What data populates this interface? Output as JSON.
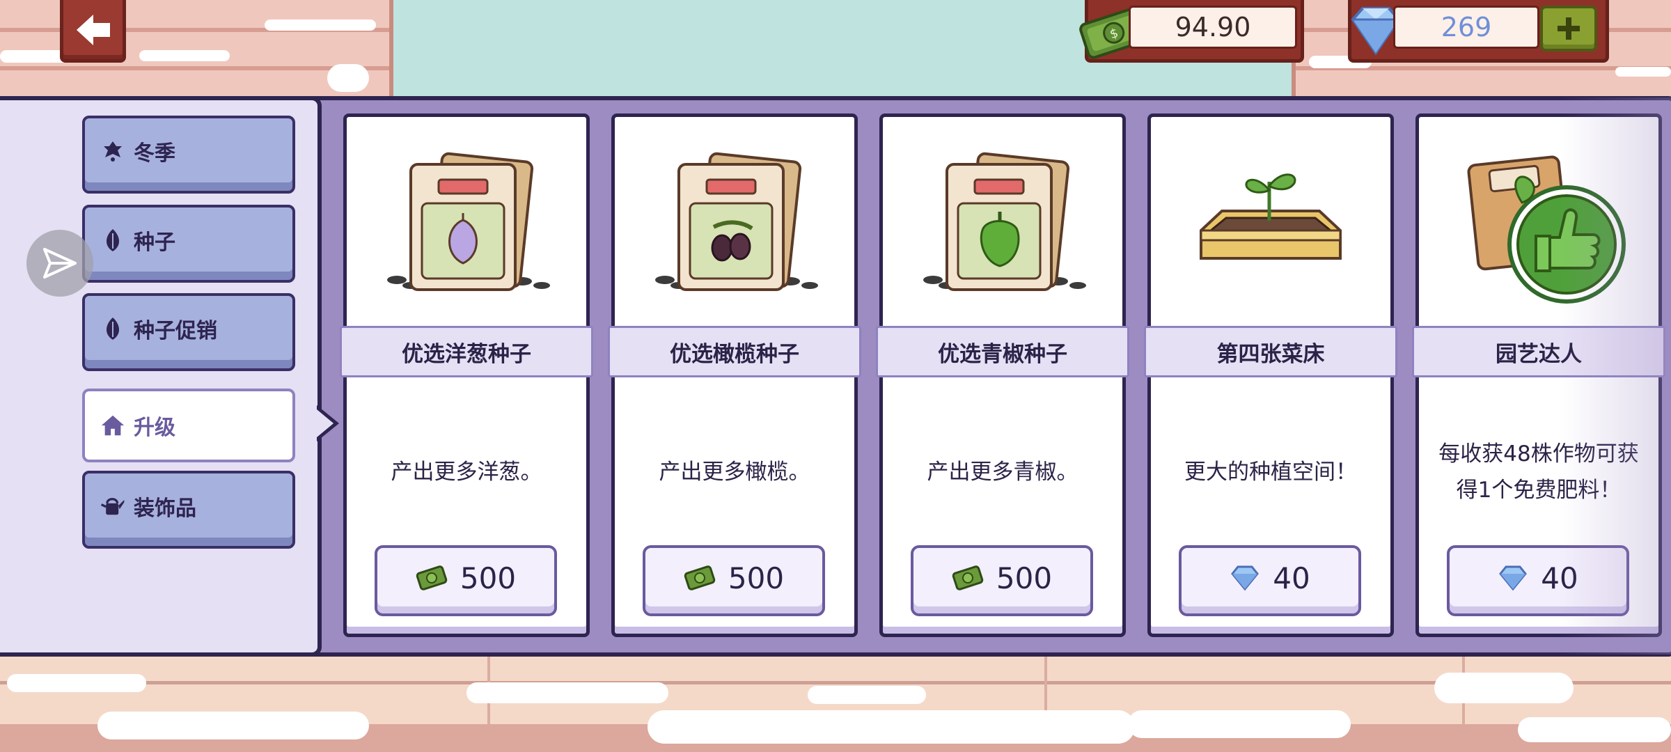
{
  "top_bar": {
    "cash_amount": "94.90",
    "gem_amount": "269",
    "back_icon": "arrow-left-icon",
    "add_icon": "plus-icon"
  },
  "sidebar": {
    "items": [
      {
        "label": "冬季",
        "icon": "winter-bell-icon",
        "active": false
      },
      {
        "label": "种子",
        "icon": "seed-icon",
        "active": false
      },
      {
        "label": "种子促销",
        "icon": "seed-icon",
        "active": false
      },
      {
        "label": "升级",
        "icon": "house-icon",
        "active": true
      },
      {
        "label": "装饰品",
        "icon": "watering-can-icon",
        "active": false
      }
    ]
  },
  "cards": [
    {
      "title": "优选洋葱种子",
      "desc": "产出更多洋葱。",
      "price": "500",
      "currency": "cash",
      "image": "onion-seed-packets"
    },
    {
      "title": "优选橄榄种子",
      "desc": "产出更多橄榄。",
      "price": "500",
      "currency": "cash",
      "image": "olive-seed-packets"
    },
    {
      "title": "优选青椒种子",
      "desc": "产出更多青椒。",
      "price": "500",
      "currency": "cash",
      "image": "pepper-seed-packets"
    },
    {
      "title": "第四张菜床",
      "desc": "更大的种植空间！",
      "price": "40",
      "currency": "gem",
      "image": "garden-bed-sprout"
    },
    {
      "title": "园艺达人",
      "desc": "每收获48株作物可获得1个免费肥料！",
      "price": "40",
      "currency": "gem",
      "image": "thumbs-up-badge"
    }
  ],
  "colors": {
    "panel": "#9d8cc1",
    "panel_border": "#2e2450",
    "sidebar": "#e5e0f4",
    "category_button": "#a7b1de",
    "title_band": "#e6e0f5",
    "cash_green": "#6a9a3a",
    "gem_blue": "#6f8fd8",
    "plus_green": "#8aa030"
  }
}
